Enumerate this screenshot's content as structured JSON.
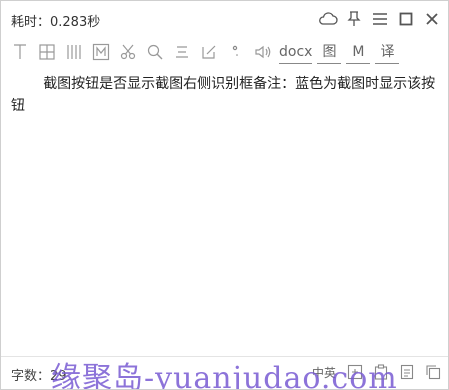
{
  "titlebar": {
    "time_text": "耗时：0.283秒",
    "icons": [
      "cloud-icon",
      "pin-icon",
      "menu-icon",
      "maximize-icon",
      "close-icon"
    ]
  },
  "toolbar": {
    "icons": [
      "text-cursor-icon",
      "table-grid-icon",
      "columns-icon",
      "m-box-icon",
      "scissors-icon",
      "search-icon",
      "align-icon",
      "edit-icon",
      "degree-icon",
      "speaker-icon"
    ],
    "docx_label": "docx",
    "image_label": "图",
    "m_label": "M",
    "translate_label": "译"
  },
  "content": {
    "text": "截图按钮是否显示截图右侧识别框备注：蓝色为截图时显示该按钮"
  },
  "bottombar": {
    "wordcount_label": "字数：29",
    "lang_label": "中英"
  },
  "watermark": {
    "text": "缘聚岛-yuanjudao.com"
  }
}
